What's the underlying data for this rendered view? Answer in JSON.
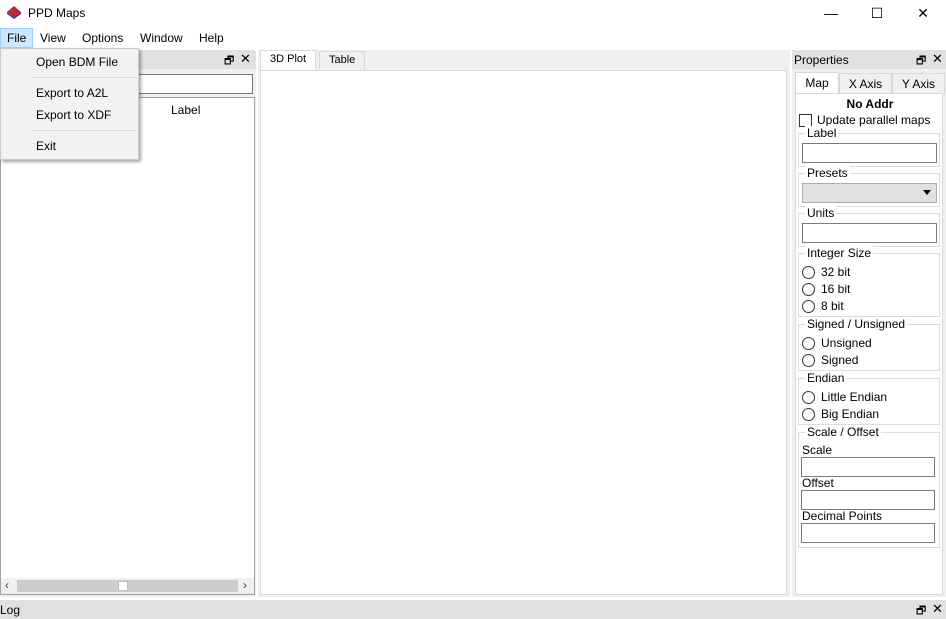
{
  "window": {
    "title": "PPD Maps",
    "min_glyph": "—",
    "max_glyph": "☐",
    "close_glyph": "✕"
  },
  "menubar": {
    "items": [
      "File",
      "View",
      "Options",
      "Window",
      "Help"
    ]
  },
  "file_menu": {
    "items": [
      "Open BDM File",
      "Export to A2L",
      "Export to XDF",
      "Exit"
    ]
  },
  "left_dock": {
    "tree_header": "Label"
  },
  "center": {
    "tabs": [
      "3D Plot",
      "Table"
    ]
  },
  "properties": {
    "title": "Properties",
    "tabs": [
      "Map",
      "X Axis",
      "Y Axis"
    ],
    "address": "No Addr",
    "update_parallel": "Update parallel maps",
    "label_group": "Label",
    "presets_group": "Presets",
    "units_group": "Units",
    "integer_size": {
      "title": "Integer Size",
      "options": [
        "32 bit",
        "16 bit",
        "8 bit"
      ]
    },
    "signed": {
      "title": "Signed / Unsigned",
      "options": [
        "Unsigned",
        "Signed"
      ]
    },
    "endian": {
      "title": "Endian",
      "options": [
        "Little Endian",
        "Big Endian"
      ]
    },
    "scale_offset": {
      "title": "Scale / Offset",
      "scale": "Scale",
      "offset": "Offset",
      "decimal": "Decimal Points"
    }
  },
  "log_dock": {
    "title": "Log"
  },
  "colors": {
    "accent_menu": "#cce8ff",
    "dock_header": "#e1e1e1",
    "panel_bg": "#f0f0f0"
  }
}
